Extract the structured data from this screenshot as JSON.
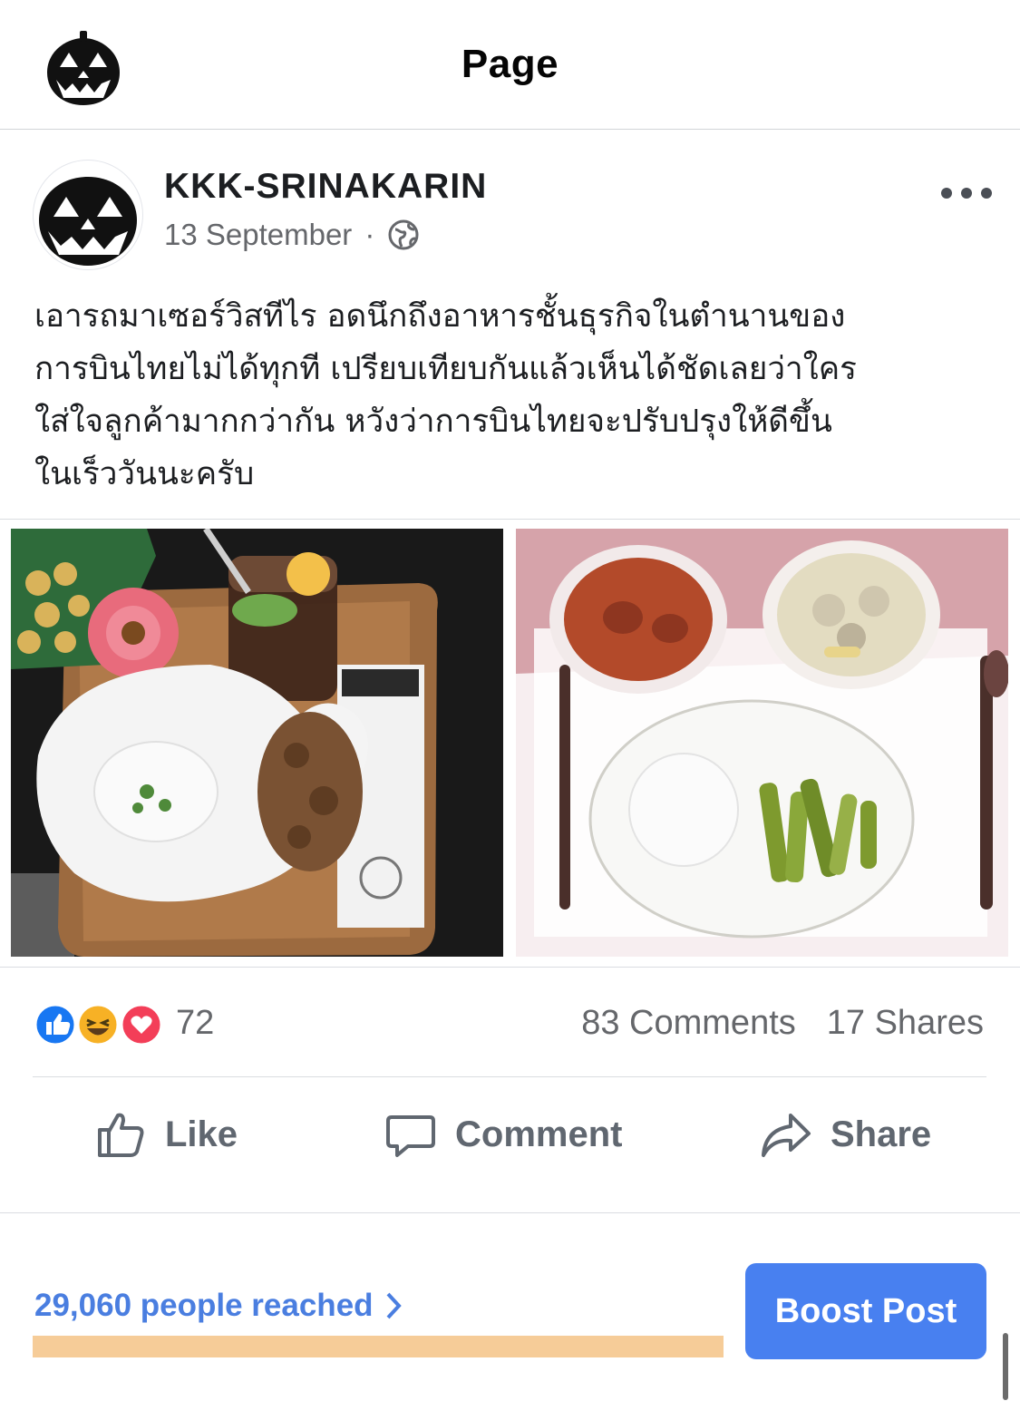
{
  "header": {
    "title": "Page",
    "avatar_icon": "jack-o-lantern-icon"
  },
  "post": {
    "author": "KKK-SRINAKARIN",
    "date": "13 September",
    "separator": "·",
    "privacy_icon": "globe-icon",
    "more_icon": "more-options-icon",
    "text": "เอารถมาเซอร์วิสทีไร อดนึกถึงอาหารชั้นธุรกิจในตำนานของ\nการบินไทยไม่ได้ทุกที เปรียบเทียบกันแล้วเห็นได้ชัดเลยว่าใคร\nใส่ใจลูกค้ามากกว่ากัน หวังว่าการบินไทยจะปรับปรุงให้ดีขึ้น\nในเร็ววันนะครับ",
    "photos": [
      {
        "description_icon": "photo-dealership-meal"
      },
      {
        "description_icon": "photo-airline-meal"
      }
    ]
  },
  "engagement": {
    "reaction_icons": [
      "like-reaction-icon",
      "haha-reaction-icon",
      "love-reaction-icon"
    ],
    "reactions_count": "72",
    "comments": "83 Comments",
    "shares": "17 Shares"
  },
  "actions": {
    "like": "Like",
    "comment": "Comment",
    "share": "Share"
  },
  "footer": {
    "reach": "29,060 people reached",
    "reach_progress": 1.0,
    "boost_button": "Boost Post"
  },
  "colors": {
    "accent": "#4880f0",
    "reach_text": "#4a7ee0",
    "reach_bar": "#f6cc98",
    "like_blue": "#1877f2",
    "love_red": "#f33e58",
    "haha_yellow": "#f7b125"
  }
}
